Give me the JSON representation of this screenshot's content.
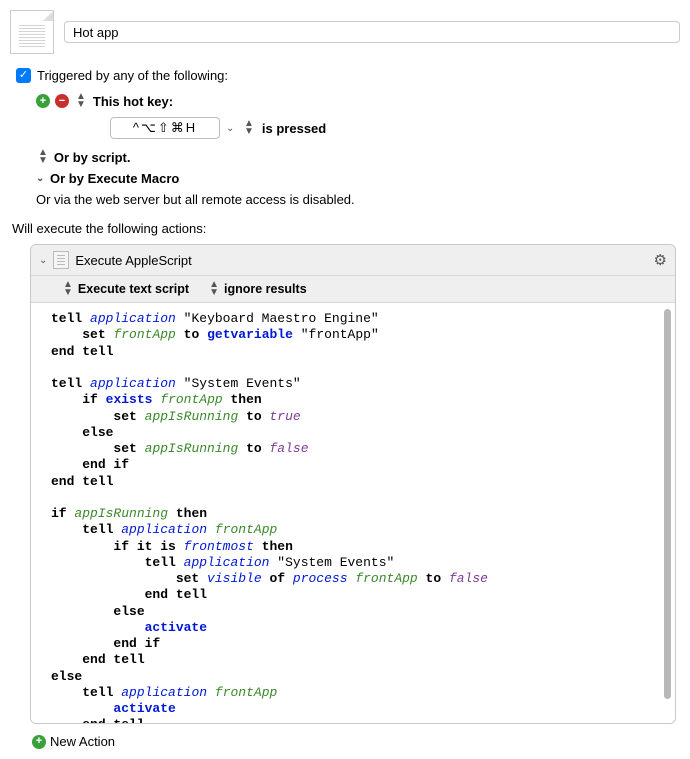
{
  "title": "Hot app",
  "triggered_by_label": "Triggered by any of the following:",
  "hotkey": {
    "label": "This hot key:",
    "value": "^⌥⇧⌘H",
    "mode": "is pressed"
  },
  "trigger_script": "Or by script.",
  "trigger_execute_macro": "Or by Execute Macro",
  "trigger_web": "Or via the web server but all remote access is disabled.",
  "will_execute_label": "Will execute the following actions:",
  "action": {
    "title": "Execute AppleScript",
    "opt1": "Execute text script",
    "opt2": "ignore results"
  },
  "new_action_label": "New Action",
  "script": {
    "l1a": "tell",
    "l1b": "application",
    "l1c": "\"Keyboard Maestro Engine\"",
    "l2a": "set",
    "l2b": "frontApp",
    "l2c": "to",
    "l2d": "getvariable",
    "l2e": "\"frontApp\"",
    "l3a": "end tell",
    "l4a": "tell",
    "l4b": "application",
    "l4c": "\"System Events\"",
    "l5a": "if",
    "l5b": "exists",
    "l5c": "frontApp",
    "l5d": "then",
    "l6a": "set",
    "l6b": "appIsRunning",
    "l6c": "to",
    "l6d": "true",
    "l7a": "else",
    "l8a": "set",
    "l8b": "appIsRunning",
    "l8c": "to",
    "l8d": "false",
    "l9a": "end if",
    "l10a": "end tell",
    "l11a": "if",
    "l11b": "appIsRunning",
    "l11c": "then",
    "l12a": "tell",
    "l12b": "application",
    "l12c": "frontApp",
    "l13a": "if it is",
    "l13b": "frontmost",
    "l13c": "then",
    "l14a": "tell",
    "l14b": "application",
    "l14c": "\"System Events\"",
    "l15a": "set",
    "l15b": "visible",
    "l15c": "of",
    "l15d": "process",
    "l15e": "frontApp",
    "l15f": "to",
    "l15g": "false",
    "l16a": "end tell",
    "l17a": "else",
    "l18a": "activate",
    "l19a": "end if",
    "l20a": "end tell",
    "l21a": "else",
    "l22a": "tell",
    "l22b": "application",
    "l22c": "frontApp",
    "l23a": "activate",
    "l24a": "end tell"
  }
}
